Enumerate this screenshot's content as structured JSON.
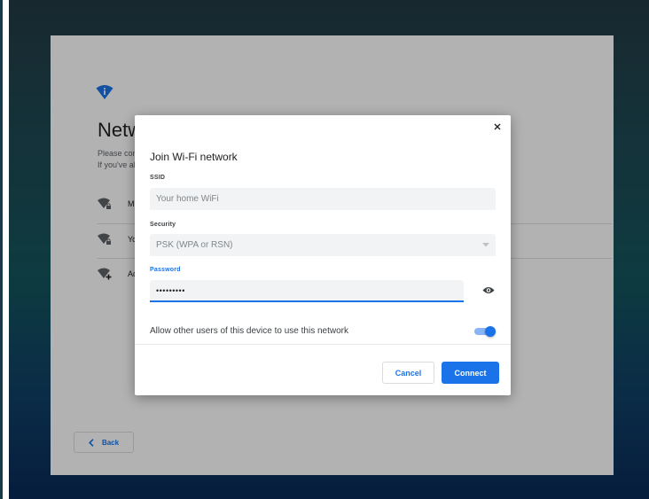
{
  "background_screen": {
    "title": "Netw",
    "subtitle_lines": [
      "Please con",
      "If you've al"
    ],
    "networks": [
      {
        "label": "MC",
        "icon": "wifi-lock-icon"
      },
      {
        "label": "You",
        "icon": "wifi-lock-icon"
      },
      {
        "label": "Add",
        "icon": "wifi-add-icon"
      }
    ],
    "back_label": "Back"
  },
  "dialog": {
    "title": "Join Wi-Fi network",
    "ssid_label": "SSID",
    "ssid_placeholder": "Your home WiFi",
    "security_label": "Security",
    "security_value": "PSK (WPA or RSN)",
    "password_label": "Password",
    "password_value": "•••••••••",
    "share_label": "Allow other users of this device to use this network",
    "share_enabled": true,
    "cancel_label": "Cancel",
    "connect_label": "Connect"
  },
  "colors": {
    "accent": "#1a73e8",
    "toggle_track": "#8ab4f8",
    "field_bg": "#f1f3f4"
  }
}
